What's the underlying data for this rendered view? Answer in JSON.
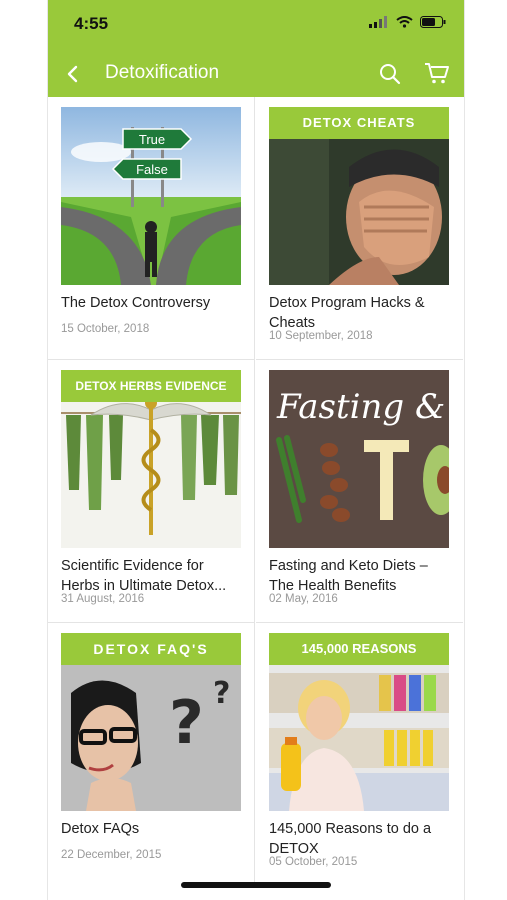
{
  "status": {
    "time": "4:55"
  },
  "nav": {
    "title": "Detoxification"
  },
  "articles": [
    {
      "banner": "",
      "title": "The Detox Controversy",
      "date": "15 October, 2018",
      "sign_top": "True",
      "sign_bottom": "False"
    },
    {
      "banner": "DETOX CHEATS",
      "title": "Detox Program Hacks & Cheats",
      "date": "10 September, 2018"
    },
    {
      "banner": "DETOX HERBS EVIDENCE",
      "title": "Scientific Evidence for Herbs in Ultimate Detox...",
      "date": "31 August, 2016"
    },
    {
      "banner": "",
      "title": "Fasting and Keto Diets – The Health Benefits",
      "date": "02 May, 2016",
      "overlay_text": "Fasting &"
    },
    {
      "banner": "DETOX FAQ'S",
      "title": "Detox FAQs",
      "date": "22 December, 2015"
    },
    {
      "banner": "145,000 REASONS",
      "title": "145,000 Reasons to do a DETOX",
      "date": "05 October, 2015"
    }
  ],
  "colors": {
    "accent": "#99c93a"
  }
}
